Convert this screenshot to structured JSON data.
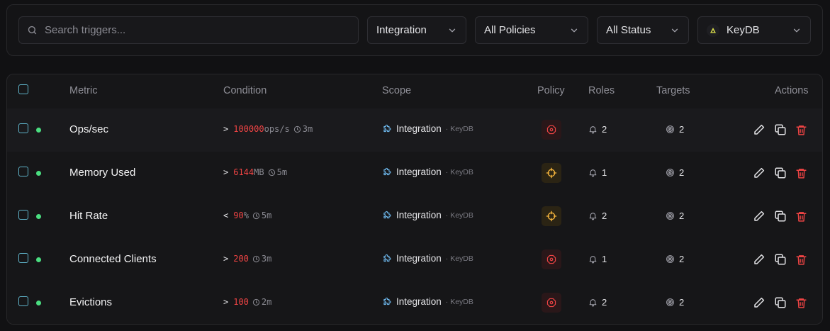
{
  "filters": {
    "search_placeholder": "Search triggers...",
    "scope_select": "Integration",
    "policy_select": "All Policies",
    "status_select": "All Status",
    "integration_select": "KeyDB"
  },
  "table": {
    "headers": {
      "metric": "Metric",
      "condition": "Condition",
      "scope": "Scope",
      "policy": "Policy",
      "roles": "Roles",
      "targets": "Targets",
      "actions": "Actions"
    },
    "rows": [
      {
        "metric": "Ops/sec",
        "operator": ">",
        "value": "100000",
        "unit": "ops/s",
        "duration": "3m",
        "scope": "Integration",
        "scope_sub": "· KeyDB",
        "policy": "critical",
        "roles": "2",
        "targets": "2",
        "status": "active"
      },
      {
        "metric": "Memory Used",
        "operator": ">",
        "value": "6144",
        "unit": "MB",
        "duration": "5m",
        "scope": "Integration",
        "scope_sub": "· KeyDB",
        "policy": "warning",
        "roles": "1",
        "targets": "2",
        "status": "active"
      },
      {
        "metric": "Hit Rate",
        "operator": "<",
        "value": "90",
        "unit": "%",
        "duration": "5m",
        "scope": "Integration",
        "scope_sub": "· KeyDB",
        "policy": "warning",
        "roles": "2",
        "targets": "2",
        "status": "active"
      },
      {
        "metric": "Connected Clients",
        "operator": ">",
        "value": "200",
        "unit": "",
        "duration": "3m",
        "scope": "Integration",
        "scope_sub": "· KeyDB",
        "policy": "critical",
        "roles": "1",
        "targets": "2",
        "status": "active"
      },
      {
        "metric": "Evictions",
        "operator": ">",
        "value": "100",
        "unit": "",
        "duration": "2m",
        "scope": "Integration",
        "scope_sub": "· KeyDB",
        "policy": "critical",
        "roles": "2",
        "targets": "2",
        "status": "active"
      }
    ]
  },
  "colors": {
    "background": "#111113",
    "panel": "#161618",
    "accent_checkbox": "#5fb3c9",
    "status_active": "#4ade80",
    "critical": "#ef4444",
    "warning": "#f5b53d",
    "delete": "#ef4444"
  },
  "icons": {
    "search": "search-icon",
    "chevron": "chevron-down-icon",
    "integration": "puzzle-icon",
    "duration": "clock-icon",
    "policy_critical": "octagon-alert-icon",
    "policy_warning": "crosshair-icon",
    "roles": "bell-icon",
    "targets": "radar-icon",
    "edit": "pencil-icon",
    "copy": "copy-icon",
    "delete": "trash-icon"
  }
}
